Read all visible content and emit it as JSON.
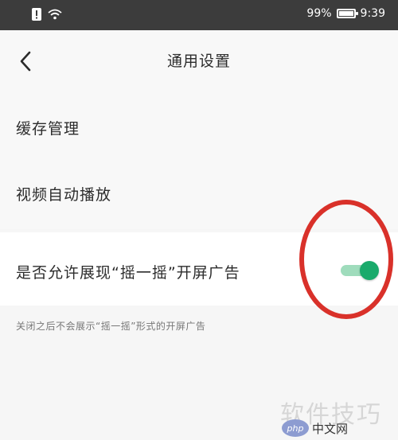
{
  "status_bar": {
    "battery_percent": "99%",
    "battery_level": 0.99,
    "time": "9:39",
    "icons": [
      "notification-icon",
      "wifi-icon",
      "battery-icon"
    ]
  },
  "header": {
    "back_icon": "chevron-left-icon",
    "title": "通用设置"
  },
  "settings": {
    "cache_label": "缓存管理",
    "video_autoplay_label": "视频自动播放",
    "shake_ad": {
      "label": "是否允许展现“摇一摇”开屏广告",
      "enabled": true,
      "hint": "关闭之后不会展示“摇一摇”形式的开屏广告"
    }
  },
  "annotation": {
    "color": "#d9312a"
  },
  "watermark": {
    "text": "软件技巧",
    "logo_text": "php",
    "site": "中文网"
  },
  "colors": {
    "toggle_on": "#1aaa6b",
    "toggle_track_on": "#9fdcbc",
    "status_bar": "#3c3c3c",
    "page_background": "#f6f6f6"
  }
}
